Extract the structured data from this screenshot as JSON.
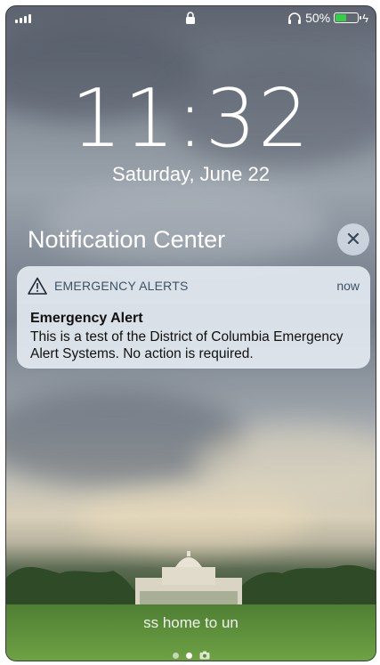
{
  "status_bar": {
    "battery_percent": "50%",
    "battery_level": 0.5,
    "battery_color": "#33d047",
    "icons": [
      "signal-icon",
      "lock-icon",
      "headphone-icon",
      "battery-icon",
      "charging-bolt-icon"
    ]
  },
  "lock_screen": {
    "time": "11:32",
    "date": "Saturday, June 22"
  },
  "notification_center": {
    "title": "Notification Center",
    "close_label": "✕"
  },
  "notification": {
    "app_name": "EMERGENCY ALERTS",
    "time": "now",
    "title": "Emergency Alert",
    "body": "This is a test of the District of Columbia Emergency Alert Systems. No action is required.",
    "icon": "warning-triangle-icon"
  },
  "bottom": {
    "unlock_hint": "ss home to un",
    "page_dots": 2,
    "active_dot": 1
  }
}
